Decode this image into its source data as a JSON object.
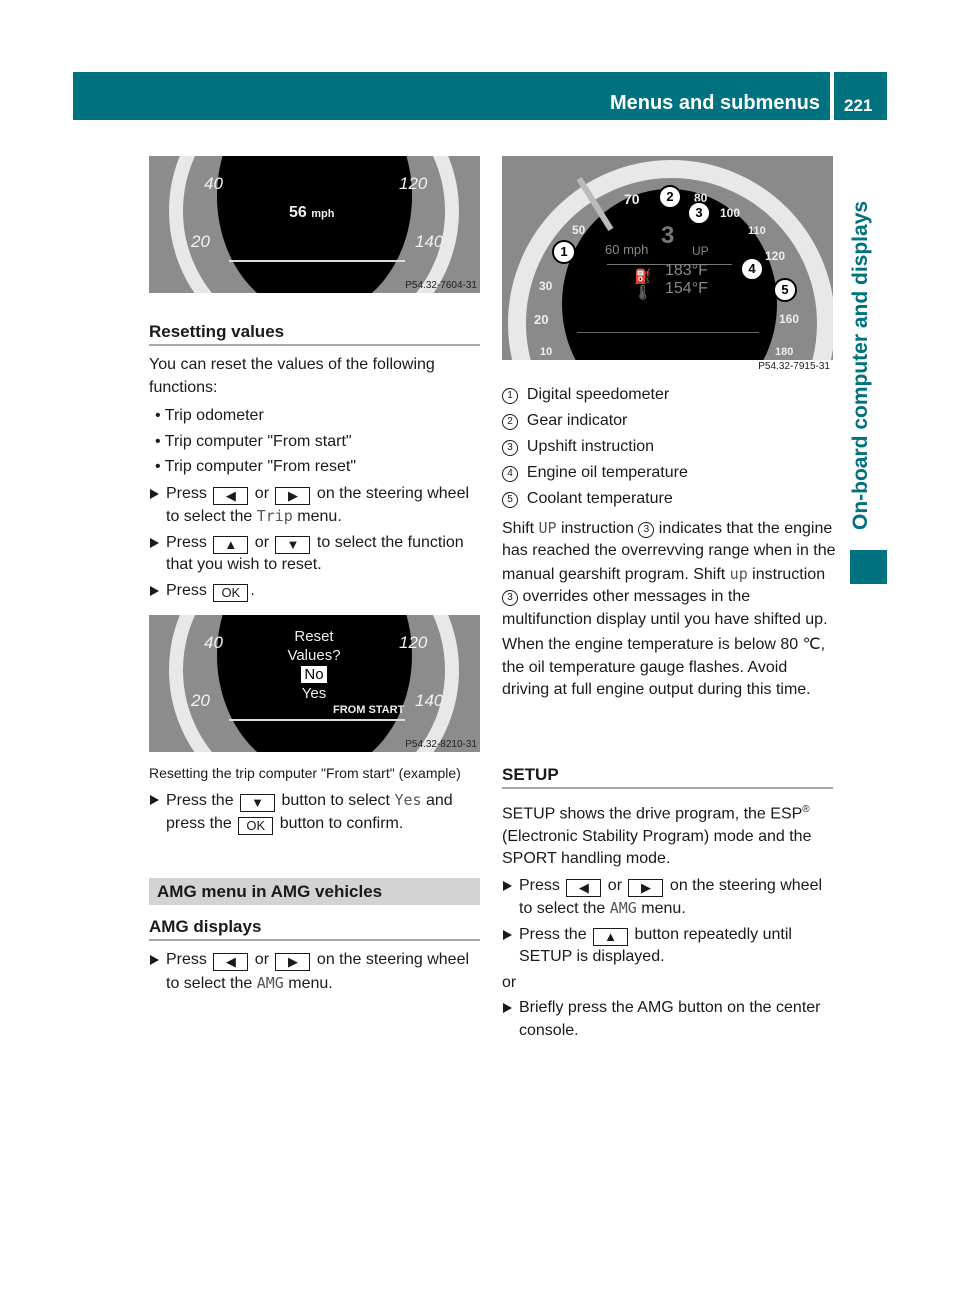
{
  "header": {
    "title": "Menus and submenus",
    "page_number": "221",
    "section_tab": "On-board computer and displays",
    "color": "#00717f"
  },
  "figure1": {
    "speed": "56",
    "unit": "mph",
    "scale": [
      "40",
      "20",
      "120",
      "140"
    ],
    "ref": "P54.32-7604-31"
  },
  "resetting": {
    "heading": "Resetting values",
    "intro": "You can reset the values of the following functions:",
    "bullets": [
      "Trip odometer",
      "Trip computer \"From start\"",
      "Trip computer \"From reset\""
    ],
    "steps": [
      [
        "Press ",
        {
          "k": "◀"
        },
        " or ",
        {
          "k": "▶"
        },
        " on the steering wheel to select the ",
        {
          "m": "Trip"
        },
        " menu."
      ],
      [
        "Press ",
        {
          "k": "▲"
        },
        " or ",
        {
          "k": "▼"
        },
        " to select the function that you wish to reset."
      ],
      [
        "Press ",
        {
          "k": "OK"
        },
        "."
      ]
    ]
  },
  "figure2": {
    "line1": "Reset",
    "line2": "Values?",
    "no": "No",
    "yes": "Yes",
    "mode": "FROM START",
    "scale": [
      "40",
      "20",
      "120",
      "140"
    ],
    "ref": "P54.32-8210-31",
    "caption": "Resetting the trip computer \"From start\" (example)"
  },
  "confirm_steps": [
    [
      "Press the ",
      {
        "k": "▼"
      },
      " button to select ",
      {
        "m": "Yes"
      },
      " and press the ",
      {
        "k": "OK"
      },
      " button to confirm."
    ]
  ],
  "amg": {
    "bar_title": "AMG menu in AMG vehicles",
    "heading": "AMG displays",
    "steps": [
      [
        "Press ",
        {
          "k": "◀"
        },
        " or ",
        {
          "k": "▶"
        },
        " on the steering wheel to select the ",
        {
          "m": "AMG"
        },
        " menu."
      ]
    ]
  },
  "figure3": {
    "speed": "60 mph",
    "gear": "3",
    "upshift": "UP",
    "oil": "183°F",
    "coolant": "154°F",
    "scale_left": [
      "70",
      "50",
      "30",
      "20",
      "10"
    ],
    "scale_right": [
      "80",
      "100",
      "110",
      "120",
      "160",
      "180"
    ],
    "callouts": [
      "1",
      "2",
      "3",
      "4",
      "5"
    ],
    "ref": "P54.32-7915-31"
  },
  "legend": [
    {
      "n": "1",
      "label": "Digital speedometer"
    },
    {
      "n": "2",
      "label": "Gear indicator"
    },
    {
      "n": "3",
      "label": "Upshift instruction"
    },
    {
      "n": "4",
      "label": "Engine oil temperature"
    },
    {
      "n": "5",
      "label": "Coolant temperature"
    }
  ],
  "shift_para": [
    "Shift ",
    {
      "m": "UP"
    },
    " instruction ",
    {
      "c": "3"
    },
    " indicates that the engine has reached the overrevving range when in the manual gearshift program. Shift ",
    {
      "m": "up"
    },
    " instruction ",
    {
      "c": "3"
    },
    " overrides other messages in the multifunction display until you have shifted up."
  ],
  "temp_para": "When the engine temperature is below 80 ℃, the oil temperature gauge flashes. Avoid driving at full engine output during this time.",
  "setup": {
    "heading": "SETUP",
    "intro": [
      "SETUP shows the drive program, the ESP",
      {
        "sup": "®"
      },
      " (Electronic Stability Program) mode and the SPORT handling mode."
    ],
    "steps": [
      [
        "Press ",
        {
          "k": "◀"
        },
        " or ",
        {
          "k": "▶"
        },
        " on the steering wheel to select the ",
        {
          "m": "AMG"
        },
        " menu."
      ],
      [
        "Press the ",
        {
          "k": "▲"
        },
        " button repeatedly until SETUP is displayed."
      ]
    ],
    "or": "or",
    "steps2": [
      [
        "Briefly press the AMG button on the center console."
      ]
    ]
  }
}
